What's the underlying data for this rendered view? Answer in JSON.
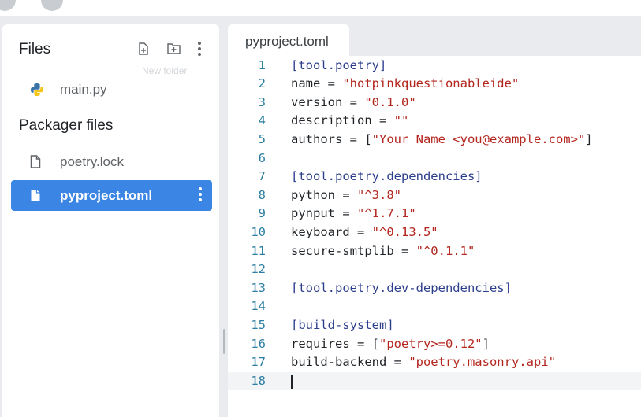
{
  "sidebar": {
    "files_title": "Files",
    "new_file_icon": "file-plus-icon",
    "new_folder_icon": "folder-plus-icon",
    "ghost_tooltip": "New folder",
    "files": [
      {
        "label": "main.py",
        "icon": "python-icon"
      }
    ],
    "packager_title": "Packager files",
    "packager_files": [
      {
        "label": "poetry.lock",
        "icon": "file-icon"
      },
      {
        "label": "pyproject.toml",
        "icon": "file-icon",
        "active": true
      }
    ],
    "accent": "#3b86e5"
  },
  "tab": {
    "label": "pyproject.toml"
  },
  "editor": {
    "current_line": 18,
    "lines": [
      {
        "n": "1",
        "parts": [
          {
            "t": "section",
            "v": "[tool.poetry]"
          }
        ]
      },
      {
        "n": "2",
        "parts": [
          {
            "t": "plain",
            "v": "name = "
          },
          {
            "t": "string",
            "v": "\"hotpinkquestionableide\""
          }
        ]
      },
      {
        "n": "3",
        "parts": [
          {
            "t": "plain",
            "v": "version = "
          },
          {
            "t": "string",
            "v": "\"0.1.0\""
          }
        ]
      },
      {
        "n": "4",
        "parts": [
          {
            "t": "plain",
            "v": "description = "
          },
          {
            "t": "string",
            "v": "\"\""
          }
        ]
      },
      {
        "n": "5",
        "parts": [
          {
            "t": "plain",
            "v": "authors = ["
          },
          {
            "t": "string",
            "v": "\"Your Name <you@example.com>\""
          },
          {
            "t": "plain",
            "v": "]"
          }
        ]
      },
      {
        "n": "6",
        "parts": []
      },
      {
        "n": "7",
        "parts": [
          {
            "t": "section",
            "v": "[tool.poetry.dependencies]"
          }
        ]
      },
      {
        "n": "8",
        "parts": [
          {
            "t": "plain",
            "v": "python = "
          },
          {
            "t": "string",
            "v": "\"^3.8\""
          }
        ]
      },
      {
        "n": "9",
        "parts": [
          {
            "t": "plain",
            "v": "pynput = "
          },
          {
            "t": "string",
            "v": "\"^1.7.1\""
          }
        ]
      },
      {
        "n": "10",
        "parts": [
          {
            "t": "plain",
            "v": "keyboard = "
          },
          {
            "t": "string",
            "v": "\"^0.13.5\""
          }
        ]
      },
      {
        "n": "11",
        "parts": [
          {
            "t": "plain",
            "v": "secure-smtplib = "
          },
          {
            "t": "string",
            "v": "\"^0.1.1\""
          }
        ]
      },
      {
        "n": "12",
        "parts": []
      },
      {
        "n": "13",
        "parts": [
          {
            "t": "section",
            "v": "[tool.poetry.dev-dependencies]"
          }
        ]
      },
      {
        "n": "14",
        "parts": []
      },
      {
        "n": "15",
        "parts": [
          {
            "t": "section",
            "v": "[build-system]"
          }
        ]
      },
      {
        "n": "16",
        "parts": [
          {
            "t": "plain",
            "v": "requires = ["
          },
          {
            "t": "string",
            "v": "\"poetry>=0.12\""
          },
          {
            "t": "plain",
            "v": "]"
          }
        ]
      },
      {
        "n": "17",
        "parts": [
          {
            "t": "plain",
            "v": "build-backend = "
          },
          {
            "t": "string",
            "v": "\"poetry.masonry.api\""
          }
        ]
      },
      {
        "n": "18",
        "parts": []
      }
    ]
  }
}
